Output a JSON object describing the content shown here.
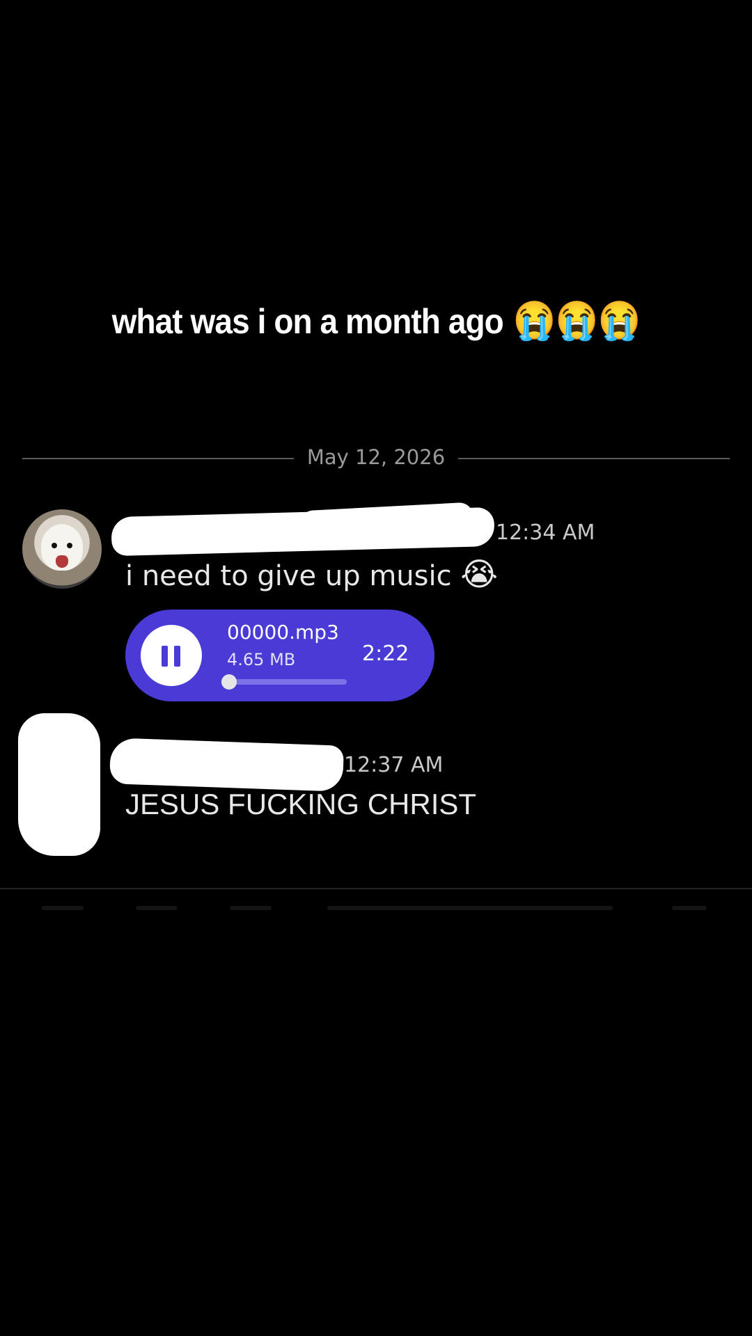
{
  "caption": {
    "text": "what was i on a month ago",
    "emojis": "😭😭😭"
  },
  "chat": {
    "date_divider": "May 12, 2026",
    "messages": [
      {
        "timestamp": "12:34 AM",
        "text": "i need to give up music",
        "emoji": "😭",
        "attachment": {
          "filename": "00000.mp3",
          "size": "4.65 MB",
          "duration": "2:22",
          "progress_fraction": 0.02,
          "state_icon": "pause-icon"
        }
      },
      {
        "timestamp": "12:37 AM",
        "text": "JESUS FUCKING CHRIST"
      }
    ]
  },
  "colors": {
    "background": "#000000",
    "audio_player": "#4a3bd6",
    "text": "#e8e8e8"
  }
}
